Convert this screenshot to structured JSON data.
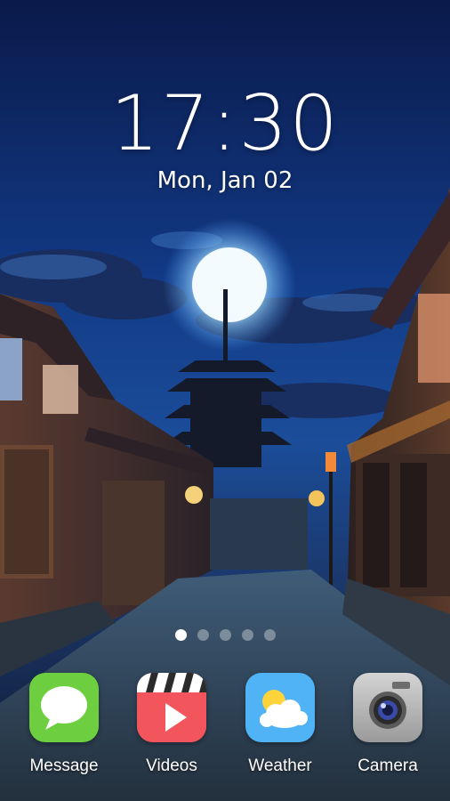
{
  "lockscreen": {
    "time": "17:30",
    "date": "Mon, Jan 02"
  },
  "pager": {
    "page_count": 5,
    "active_page": 1
  },
  "dock": {
    "apps": [
      {
        "label": "Message",
        "icon": "message-icon",
        "color": "#6dcf3f"
      },
      {
        "label": "Videos",
        "icon": "video-play-icon",
        "color": "#f2555c"
      },
      {
        "label": "Weather",
        "icon": "weather-icon",
        "color": "#4fb3f5"
      },
      {
        "label": "Camera",
        "icon": "camera-icon",
        "color": "#b8b8b8"
      }
    ]
  }
}
